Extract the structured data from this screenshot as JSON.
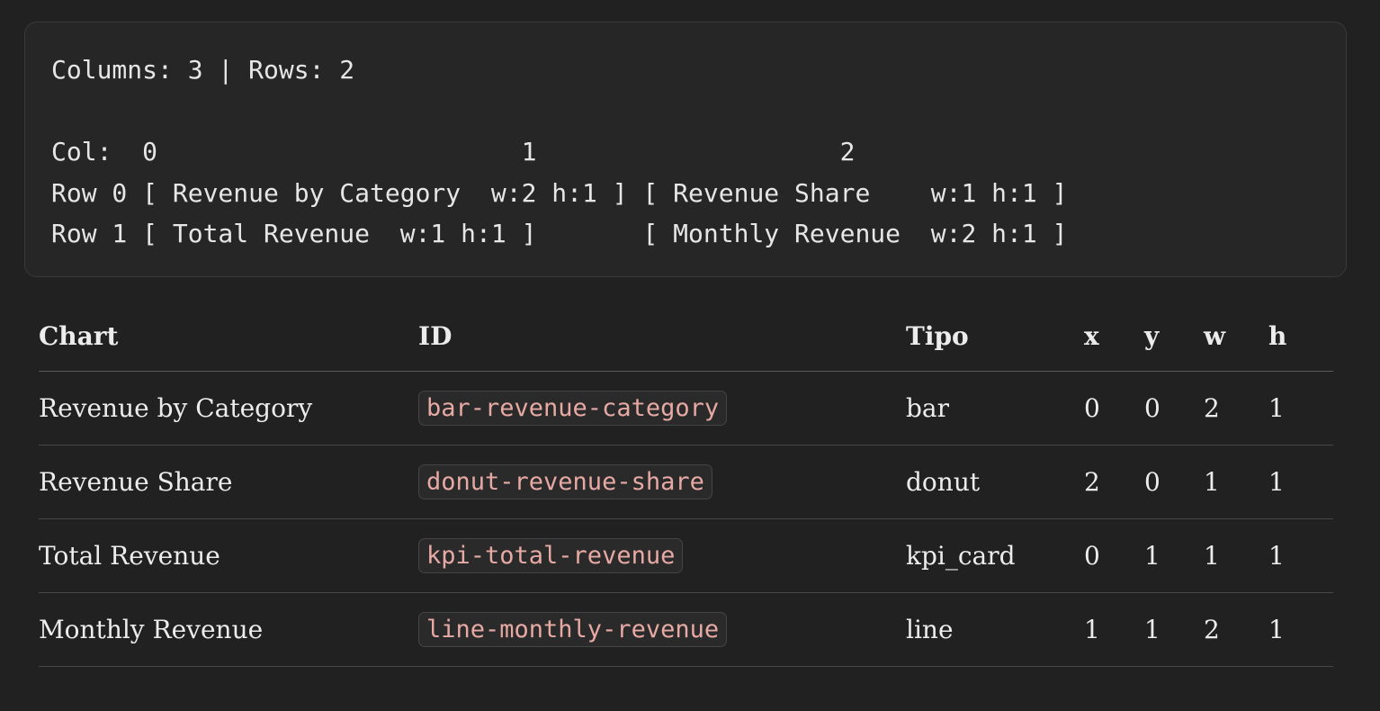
{
  "grid_block": {
    "lines": [
      "Columns: 3 | Rows: 2",
      "",
      "Col:  0                        1                    2",
      "Row 0 [ Revenue by Category  w:2 h:1 ] [ Revenue Share    w:1 h:1 ]",
      "Row 1 [ Total Revenue  w:1 h:1 ]       [ Monthly Revenue  w:2 h:1 ]"
    ]
  },
  "table": {
    "headers": [
      "Chart",
      "ID",
      "Tipo",
      "x",
      "y",
      "w",
      "h"
    ],
    "rows": [
      {
        "chart": "Revenue by Category",
        "id": "bar-revenue-category",
        "tipo": "bar",
        "x": "0",
        "y": "0",
        "w": "2",
        "h": "1"
      },
      {
        "chart": "Revenue Share",
        "id": "donut-revenue-share",
        "tipo": "donut",
        "x": "2",
        "y": "0",
        "w": "1",
        "h": "1"
      },
      {
        "chart": "Total Revenue",
        "id": "kpi-total-revenue",
        "tipo": "kpi_card",
        "x": "0",
        "y": "1",
        "w": "1",
        "h": "1"
      },
      {
        "chart": "Monthly Revenue",
        "id": "line-monthly-revenue",
        "tipo": "line",
        "x": "1",
        "y": "1",
        "w": "2",
        "h": "1"
      }
    ]
  },
  "colors": {
    "background": "#212121",
    "code_background": "#262626",
    "inline_code_text": "#e7a9a4"
  }
}
